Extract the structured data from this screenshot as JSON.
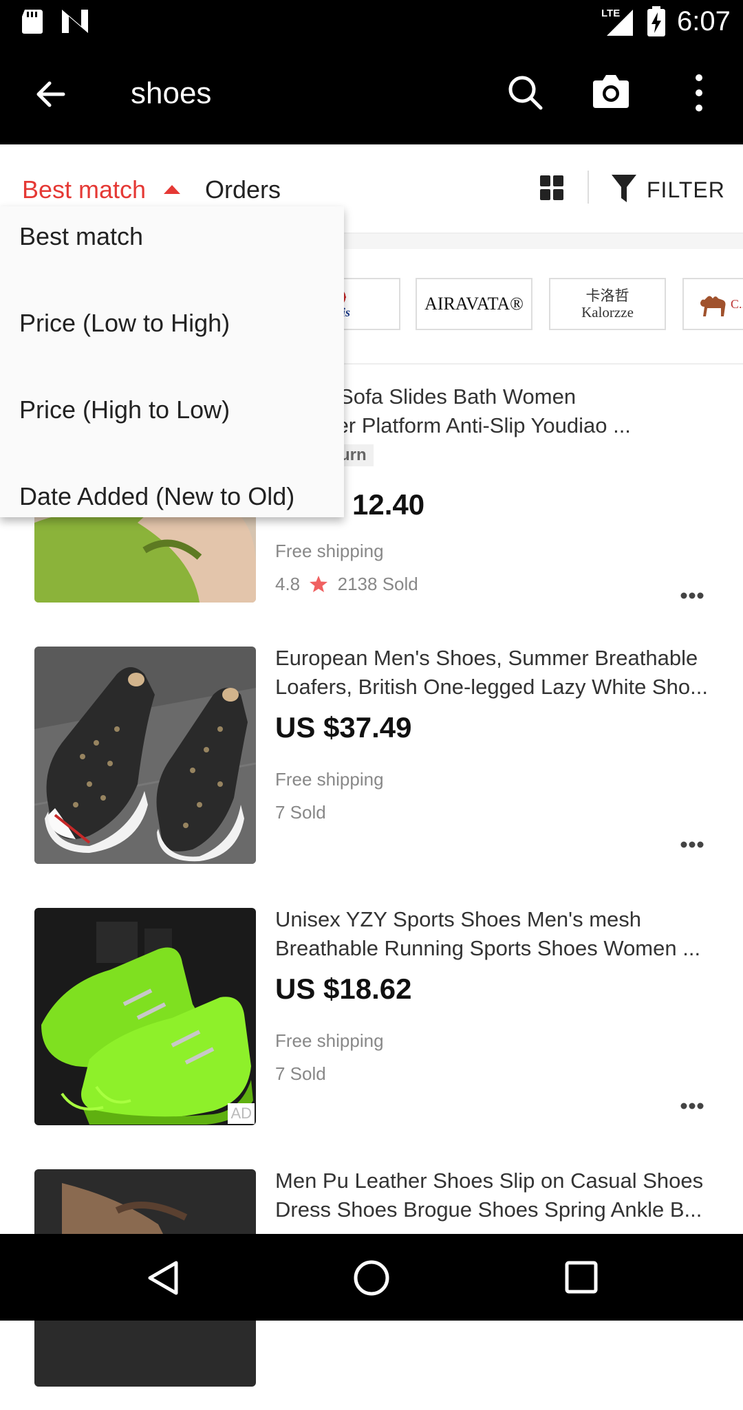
{
  "status_bar": {
    "time": "6:07",
    "network": "LTE"
  },
  "app_bar": {
    "query": "shoes"
  },
  "sort_bar": {
    "active_sort": "Best match",
    "orders_label": "Orders",
    "filter_label": "FILTER"
  },
  "dropdown": {
    "options": [
      {
        "label": "Best match"
      },
      {
        "label": "Price (Low to High)"
      },
      {
        "label": "Price (High to Low)"
      },
      {
        "label": "Date Added (New to Old)"
      }
    ]
  },
  "brands": [
    {
      "name": "AIRAVATA®"
    },
    {
      "name_line1": "卡洛哲",
      "name_line2": "Kalorzze"
    },
    {
      "name": "C..."
    }
  ],
  "products": [
    {
      "title": "s Men Sofa Slides Bath Women Summer Platform Anti-Slip Youdiao ...",
      "title_line1": "s Men Sofa Slides Bath Women",
      "title_line2": "Summer Platform Anti-Slip Youdiao ...",
      "tag": "turn",
      "price": "12.40",
      "shipping": "Free shipping",
      "rating": "4.8",
      "sold": "2138 Sold"
    },
    {
      "title": "European Men's Shoes, Summer Breathable Loafers, British One-legged Lazy White Sho...",
      "price": "US $37.49",
      "shipping": "Free shipping",
      "sold": "7 Sold"
    },
    {
      "title": "Unisex YZY Sports Shoes Men's mesh Breathable Running Sports Shoes Women ...",
      "price": "US $18.62",
      "shipping": "Free shipping",
      "sold": "7 Sold",
      "ad_label": "AD"
    },
    {
      "title": "Men Pu Leather Shoes Slip on Casual Shoes Dress Shoes Brogue Shoes Spring Ankle B..."
    }
  ],
  "colors": {
    "accent": "#e53935",
    "bar": "#000000",
    "price": "#111111",
    "muted": "#888888"
  }
}
